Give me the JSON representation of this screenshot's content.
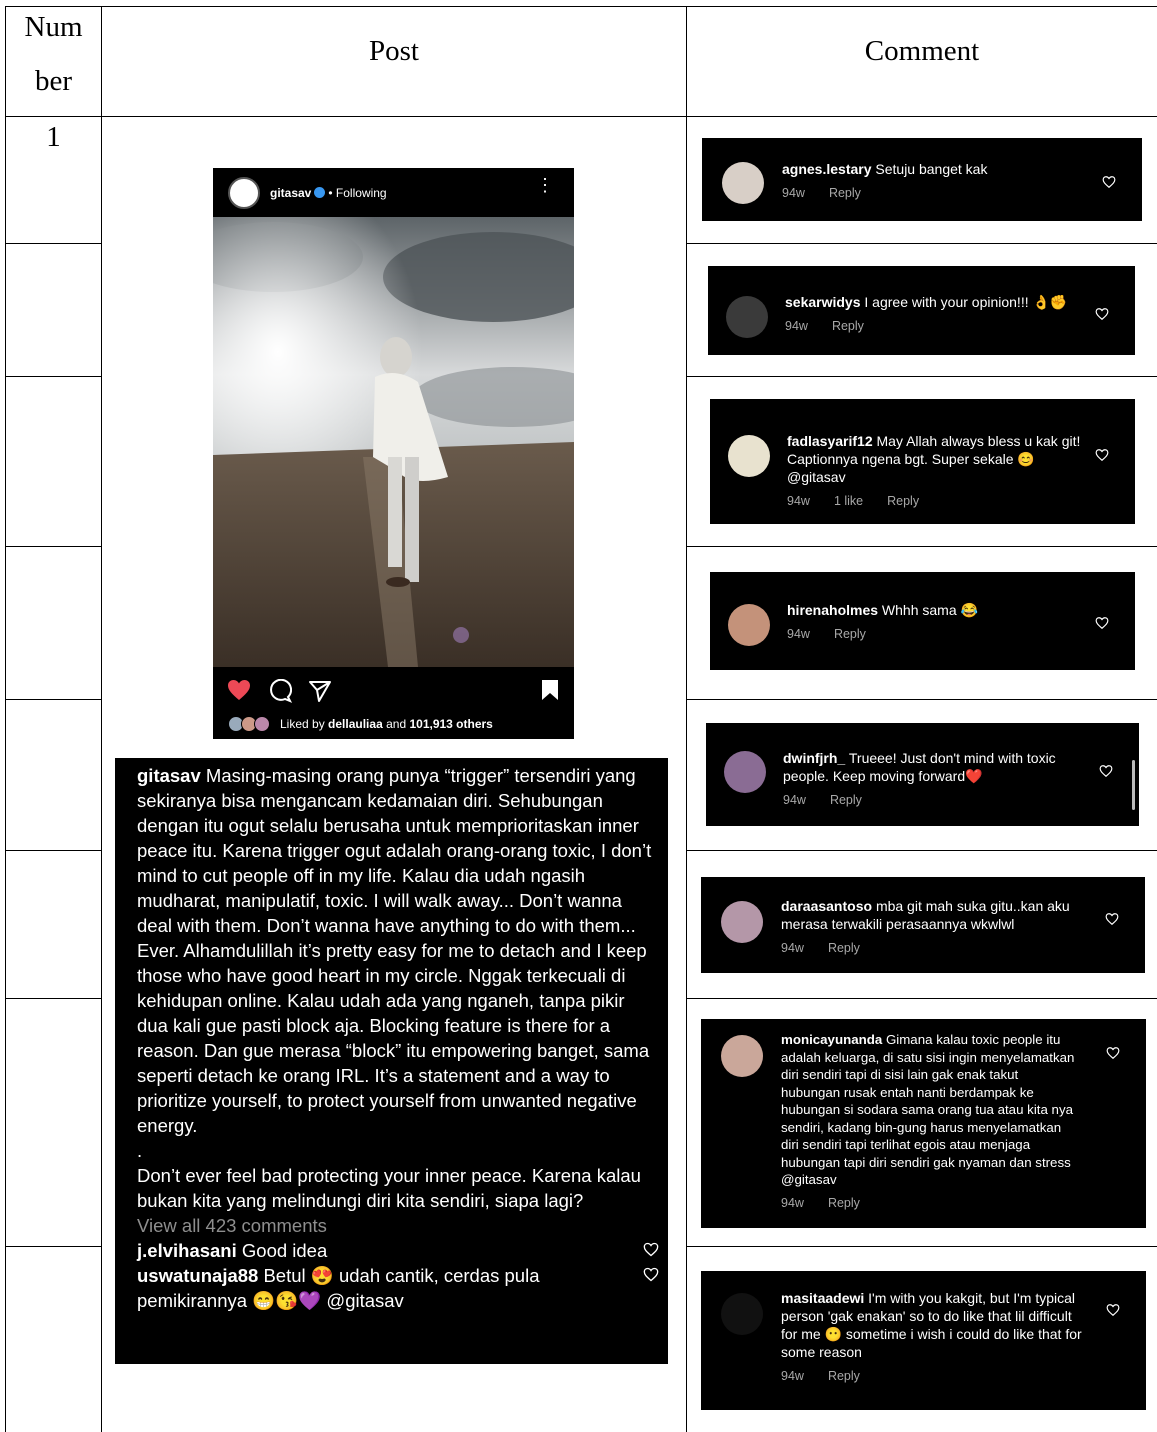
{
  "table": {
    "header": {
      "number": "Num ber",
      "number_line1": "Num",
      "number_line2": "ber",
      "post": "Post",
      "comment": "Comment"
    },
    "row_number": "1"
  },
  "post": {
    "username": "gitasav",
    "following": "• Following",
    "liked_prefix": "Liked by",
    "liked_user": "dellauliaa",
    "liked_and": "and",
    "liked_count": "101,913 others",
    "colors": {
      "heart": "#ed4956",
      "bg": "#000000",
      "verified": "#3897f0"
    }
  },
  "caption": {
    "username": "gitasav",
    "text1": "Masing-masing orang punya “trigger” tersendiri yang sekiranya bisa mengancam kedamaian diri. Sehubungan dengan itu ogut selalu berusaha untuk memprioritaskan inner peace itu. Karena trigger ogut adalah orang-orang toxic, I don’t mind to cut people off in my life. Kalau dia udah ngasih mudharat, manipulatif, toxic. I will walk away... Don’t wanna deal with them. Don’t wanna have anything to do with them... Ever. Alhamdulillah it’s pretty easy for me to detach and I keep those who have good heart in my circle. Nggak terkecuali di kehidupan online. Kalau udah ada yang nganeh, tanpa pikir dua kali gue pasti block aja. Blocking feature is there for a reason. Dan gue merasa “block” itu empowering banget, sama seperti detach ke orang IRL. It’s a statement and a way to prioritize yourself, to protect yourself from unwanted negative energy.",
    "dot": ".",
    "text2": "Don’t ever feel bad protecting your inner peace. Karena kalau bukan kita yang melindungi diri kita sendiri, siapa lagi?",
    "view_all": "View all 423 comments",
    "c1_user": "j.elvihasani",
    "c1_text": "Good idea",
    "c2_user": "uswatunaja88",
    "c2_text": "Betul 😍 udah cantik, cerdas pula pemikirannya 😁😘💜 @gitasav"
  },
  "comments": [
    {
      "user": "agnes.lestary",
      "text": "Setuju banget kak",
      "age": "94w",
      "likes": "",
      "reply": "Reply"
    },
    {
      "user": "sekarwidys",
      "text": "I agree with your opinion!!! 👌✊",
      "age": "94w",
      "likes": "",
      "reply": "Reply"
    },
    {
      "user": "fadlasyarif12",
      "text": "May Allah always bless u kak git! Captionnya ngena bgt. Super sekale 😊 @gitasav",
      "age": "94w",
      "likes": "1 like",
      "reply": "Reply"
    },
    {
      "user": "hirenaholmes",
      "text": "Whhh sama 😂",
      "age": "94w",
      "likes": "",
      "reply": "Reply"
    },
    {
      "user": "dwinfjrh_",
      "text": "Trueee! Just don't mind with toxic people. Keep moving forward❤️",
      "age": "94w",
      "likes": "",
      "reply": "Reply"
    },
    {
      "user": "daraasantoso",
      "text": "mba git mah suka gitu..kan aku merasa terwakili perasaannya wkwlwl",
      "age": "94w",
      "likes": "",
      "reply": "Reply"
    },
    {
      "user": "monicayunanda",
      "text": "Gimana kalau toxic people itu adalah keluarga, di satu sisi ingin menyelamatkan diri sendiri tapi di sisi lain gak enak takut hubungan rusak entah nanti berdampak ke hubungan si sodara sama orang tua atau kita nya sendiri, kadang bin-gung harus menyelamatkan diri sendiri tapi terlihat egois atau menjaga hubungan tapi diri sendiri gak nyaman dan stress @gitasav",
      "age": "94w",
      "likes": "",
      "reply": "Reply"
    },
    {
      "user": "masitaadewi",
      "text": "I'm with you kakgit, but I'm typical person 'gak enakan' so to do like that lil difficult for me 😶 sometime i wish i could do like that for some reason",
      "age": "94w",
      "likes": "",
      "reply": "Reply"
    }
  ]
}
